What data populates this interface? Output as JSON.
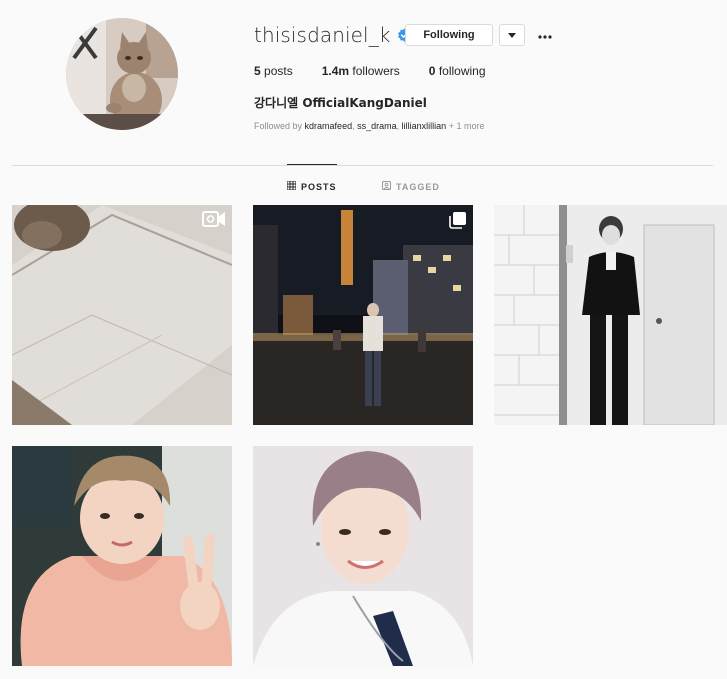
{
  "profile": {
    "username": "thisisdaniel_k",
    "verified": true,
    "follow_button_label": "Following",
    "full_name": "강다니엘 OfficialKangDaniel",
    "avatar_icon": "profile-avatar-cat"
  },
  "stats": {
    "posts_count": "5",
    "posts_label": "posts",
    "followers_count": "1.4m",
    "followers_label": "followers",
    "following_count": "0",
    "following_label": "following"
  },
  "followed_by": {
    "prefix": "Followed by",
    "accounts": [
      "kdramafeed",
      "ss_drama",
      "lillianxlillian"
    ],
    "more": "+ 1 more"
  },
  "tabs": [
    {
      "label": "POSTS",
      "icon": "grid-icon",
      "active": true
    },
    {
      "label": "TAGGED",
      "icon": "tag-icon",
      "active": false
    }
  ],
  "posts": [
    {
      "type": "video",
      "icon": "video-icon",
      "subject": "cat on marble floor"
    },
    {
      "type": "carousel",
      "icon": "multiple-posts-icon",
      "subject": "night street"
    },
    {
      "type": "photo",
      "subject": "black and white suit"
    },
    {
      "type": "photo",
      "subject": "selfie pink hoodie"
    },
    {
      "type": "photo",
      "subject": "selfie white shirt"
    }
  ],
  "colors": {
    "background": "#fafafa",
    "text": "#262626",
    "muted": "#8e8e8e",
    "border": "#dbdbdb",
    "verified_blue": "#3897f0"
  }
}
